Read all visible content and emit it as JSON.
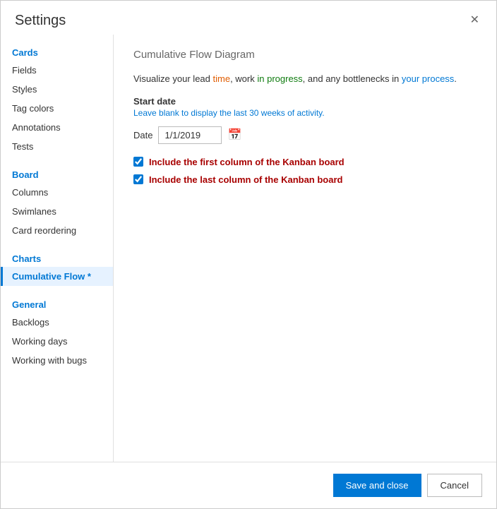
{
  "dialog": {
    "title": "Settings",
    "close_label": "✕"
  },
  "sidebar": {
    "sections": [
      {
        "header": "Cards",
        "items": [
          {
            "label": "Fields",
            "id": "fields",
            "active": false
          },
          {
            "label": "Styles",
            "id": "styles",
            "active": false
          },
          {
            "label": "Tag colors",
            "id": "tag-colors",
            "active": false
          },
          {
            "label": "Annotations",
            "id": "annotations",
            "active": false
          },
          {
            "label": "Tests",
            "id": "tests",
            "active": false
          }
        ]
      },
      {
        "header": "Board",
        "items": [
          {
            "label": "Columns",
            "id": "columns",
            "active": false
          },
          {
            "label": "Swimlanes",
            "id": "swimlanes",
            "active": false
          },
          {
            "label": "Card reordering",
            "id": "card-reordering",
            "active": false
          }
        ]
      },
      {
        "header": "Charts",
        "items": [
          {
            "label": "Cumulative Flow *",
            "id": "cumulative-flow",
            "active": true
          }
        ]
      },
      {
        "header": "General",
        "items": [
          {
            "label": "Backlogs",
            "id": "backlogs",
            "active": false
          },
          {
            "label": "Working days",
            "id": "working-days",
            "active": false
          },
          {
            "label": "Working with bugs",
            "id": "working-with-bugs",
            "active": false
          }
        ]
      }
    ]
  },
  "main": {
    "section_title": "Cumulative Flow Diagram",
    "description": "Visualize your lead time, work in progress, and any bottlenecks in your process.",
    "description_parts": {
      "before": "Visualize your lead ",
      "time": "time",
      "between1": ", work ",
      "progress": "in progress",
      "between2": ", and any bottlenecks in ",
      "process": "your process",
      "after": "."
    },
    "start_date_label": "Start date",
    "start_date_hint": "Leave blank to display the last 30 weeks of activity.",
    "date_label": "Date",
    "date_value": "1/1/2019",
    "checkbox1_label": "Include the first column of the Kanban board",
    "checkbox2_label": "Include the last column of the Kanban board",
    "checkbox1_checked": true,
    "checkbox2_checked": true
  },
  "footer": {
    "save_label": "Save and close",
    "cancel_label": "Cancel"
  }
}
